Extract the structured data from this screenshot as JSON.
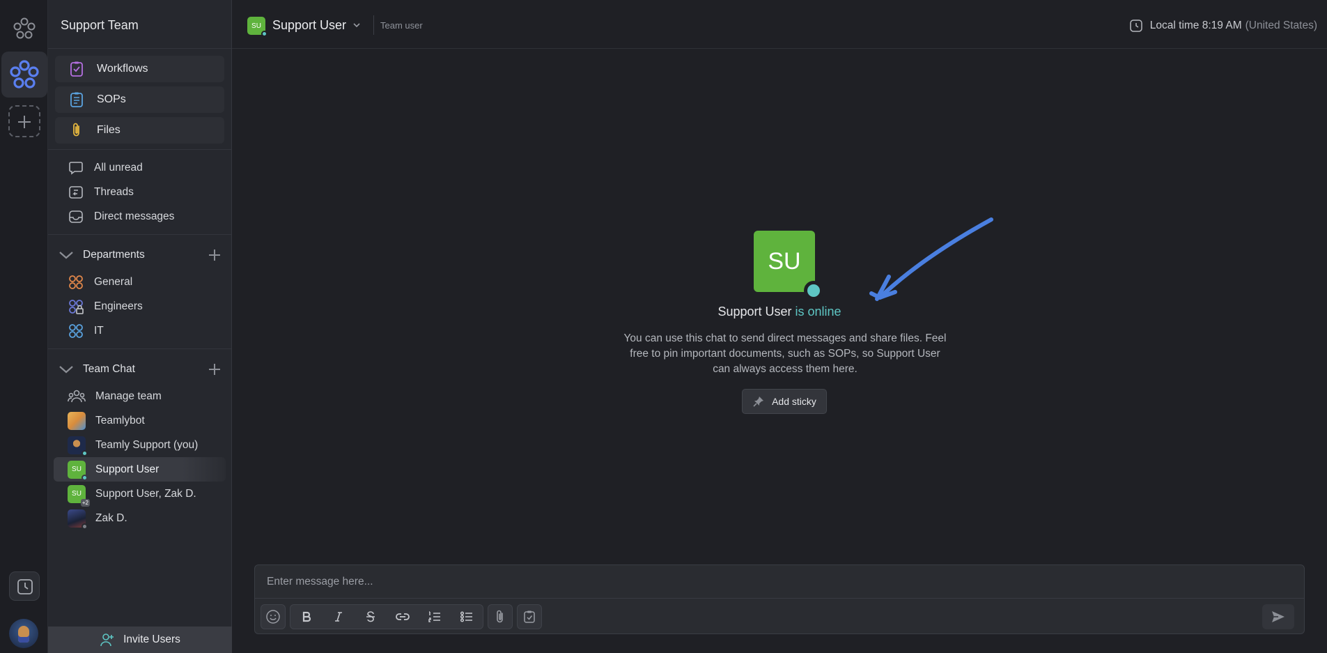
{
  "workspace": {
    "name": "Support Team"
  },
  "quick_links": [
    {
      "label": "Workflows",
      "icon": "workflow-icon"
    },
    {
      "label": "SOPs",
      "icon": "sop-icon"
    },
    {
      "label": "Files",
      "icon": "paperclip-icon"
    }
  ],
  "nav": [
    {
      "label": "All unread",
      "icon": "chat-bubble-icon"
    },
    {
      "label": "Threads",
      "icon": "threads-icon"
    },
    {
      "label": "Direct messages",
      "icon": "inbox-icon"
    }
  ],
  "departments": {
    "title": "Departments",
    "items": [
      {
        "label": "General",
        "color": "#e2874a"
      },
      {
        "label": "Engineers",
        "color": "#6b79d8"
      },
      {
        "label": "IT",
        "color": "#5aa3e0"
      }
    ]
  },
  "team_chat": {
    "title": "Team Chat",
    "items": [
      {
        "label": "Manage team"
      },
      {
        "label": "Teamlybot"
      },
      {
        "label": "Teamly Support (you)"
      },
      {
        "label": "Support User",
        "initials": "SU"
      },
      {
        "label": "Support User, Zak D.",
        "initials": "SU",
        "badge": "+2"
      },
      {
        "label": "Zak D."
      }
    ]
  },
  "invite": {
    "label": "Invite Users"
  },
  "topbar": {
    "user_initials": "SU",
    "user_name": "Support User",
    "role": "Team user",
    "time_prefix": "Local time 8:19 AM",
    "time_region": "(United States)"
  },
  "profile": {
    "initials": "SU",
    "name": "Support User",
    "status": "is online",
    "description": "You can use this chat to send direct messages and share files. Feel free to pin important documents, such as SOPs, so Support User can always access them here.",
    "sticky_label": "Add sticky"
  },
  "composer": {
    "placeholder": "Enter message here..."
  },
  "colors": {
    "accent": "#5ec6c4",
    "avatar_green": "#5fb33d",
    "arrow": "#4a7fe0"
  }
}
